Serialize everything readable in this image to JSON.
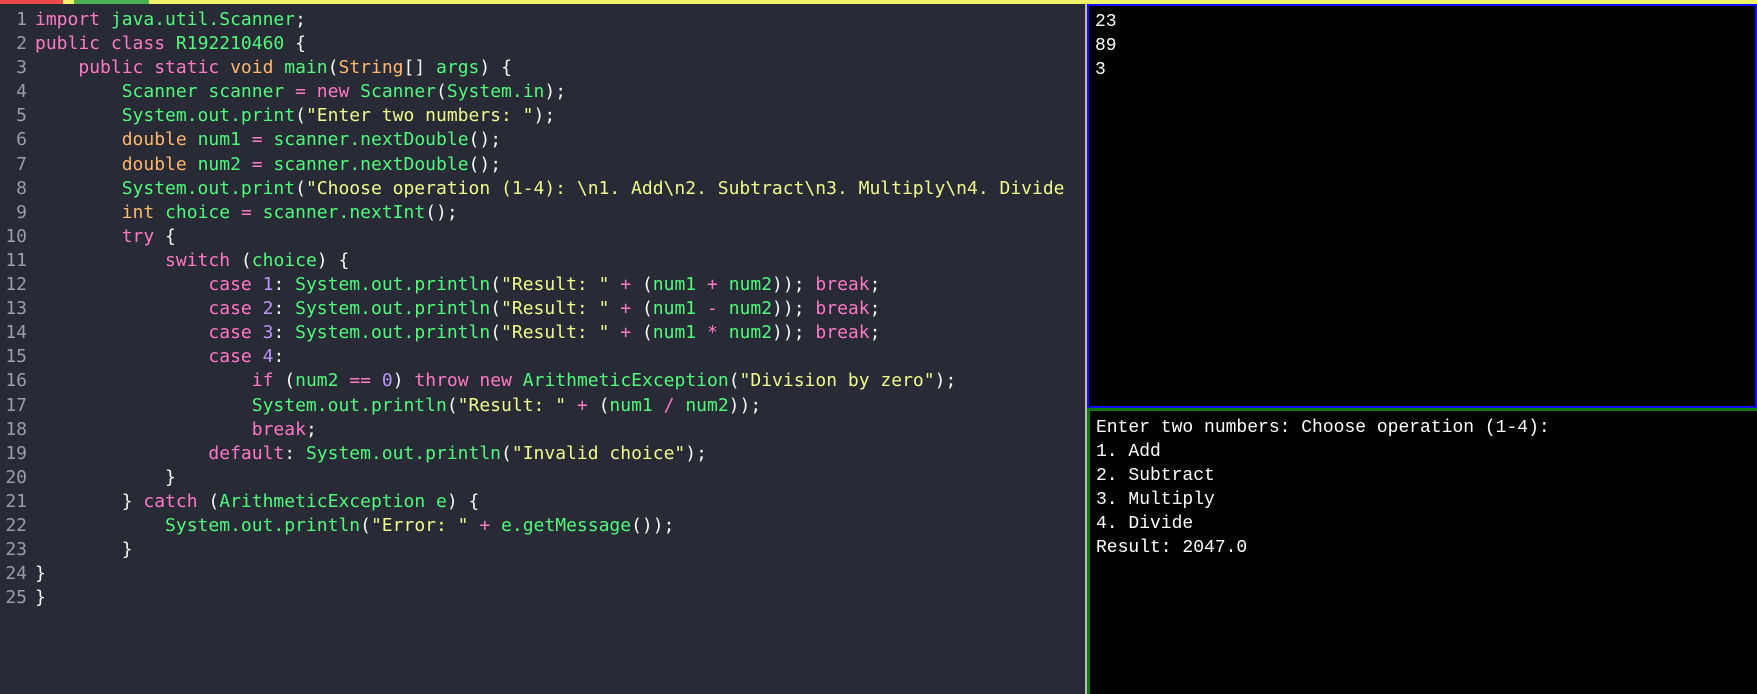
{
  "colors": {
    "background": "#282a36",
    "keyword": "#ff79c6",
    "identifier": "#50fa7b",
    "type": "#ffb86c",
    "string": "#f1fa8c",
    "number": "#bd93f9",
    "input_border": "#1010ff",
    "output_border": "#0b7d0b"
  },
  "editor": {
    "lines": [
      [
        [
          "k",
          "import"
        ],
        [
          "w",
          " "
        ],
        [
          "g",
          "java.util.Scanner"
        ],
        [
          "w",
          ";"
        ]
      ],
      [
        [
          "k",
          "public class"
        ],
        [
          "w",
          " "
        ],
        [
          "g",
          "R192210460"
        ],
        [
          "w",
          " {"
        ]
      ],
      [
        [
          "w",
          "    "
        ],
        [
          "k",
          "public static"
        ],
        [
          "w",
          " "
        ],
        [
          "o",
          "void"
        ],
        [
          "w",
          " "
        ],
        [
          "g",
          "main"
        ],
        [
          "w",
          "("
        ],
        [
          "o",
          "String"
        ],
        [
          "w",
          "[] "
        ],
        [
          "g",
          "args"
        ],
        [
          "w",
          ") {"
        ]
      ],
      [
        [
          "w",
          "        "
        ],
        [
          "g",
          "Scanner scanner"
        ],
        [
          "w",
          " "
        ],
        [
          "k",
          "="
        ],
        [
          "w",
          " "
        ],
        [
          "k",
          "new"
        ],
        [
          "w",
          " "
        ],
        [
          "g",
          "Scanner"
        ],
        [
          "w",
          "("
        ],
        [
          "g",
          "System.in"
        ],
        [
          "w",
          ");"
        ]
      ],
      [
        [
          "w",
          "        "
        ],
        [
          "g",
          "System.out.print"
        ],
        [
          "w",
          "("
        ],
        [
          "y",
          "\"Enter two numbers: \""
        ],
        [
          "w",
          ");"
        ]
      ],
      [
        [
          "w",
          "        "
        ],
        [
          "o",
          "double"
        ],
        [
          "w",
          " "
        ],
        [
          "g",
          "num1"
        ],
        [
          "w",
          " "
        ],
        [
          "k",
          "="
        ],
        [
          "w",
          " "
        ],
        [
          "g",
          "scanner.nextDouble"
        ],
        [
          "w",
          "();"
        ]
      ],
      [
        [
          "w",
          "        "
        ],
        [
          "o",
          "double"
        ],
        [
          "w",
          " "
        ],
        [
          "g",
          "num2"
        ],
        [
          "w",
          " "
        ],
        [
          "k",
          "="
        ],
        [
          "w",
          " "
        ],
        [
          "g",
          "scanner.nextDouble"
        ],
        [
          "w",
          "();"
        ]
      ],
      [
        [
          "w",
          "        "
        ],
        [
          "g",
          "System.out.print"
        ],
        [
          "w",
          "("
        ],
        [
          "y",
          "\"Choose operation (1-4): \\n1. Add\\n2. Subtract\\n3. Multiply\\n4. Divide"
        ]
      ],
      [
        [
          "w",
          "        "
        ],
        [
          "o",
          "int"
        ],
        [
          "w",
          " "
        ],
        [
          "g",
          "choice"
        ],
        [
          "w",
          " "
        ],
        [
          "k",
          "="
        ],
        [
          "w",
          " "
        ],
        [
          "g",
          "scanner.nextInt"
        ],
        [
          "w",
          "();"
        ]
      ],
      [
        [
          "w",
          "        "
        ],
        [
          "k",
          "try"
        ],
        [
          "w",
          " {"
        ]
      ],
      [
        [
          "w",
          "            "
        ],
        [
          "k",
          "switch"
        ],
        [
          "w",
          " ("
        ],
        [
          "g",
          "choice"
        ],
        [
          "w",
          ") {"
        ]
      ],
      [
        [
          "w",
          "                "
        ],
        [
          "k",
          "case"
        ],
        [
          "w",
          " "
        ],
        [
          "p",
          "1"
        ],
        [
          "w",
          ": "
        ],
        [
          "g",
          "System.out.println"
        ],
        [
          "w",
          "("
        ],
        [
          "y",
          "\"Result: \""
        ],
        [
          "w",
          " "
        ],
        [
          "k",
          "+"
        ],
        [
          "w",
          " ("
        ],
        [
          "g",
          "num1"
        ],
        [
          "w",
          " "
        ],
        [
          "k",
          "+"
        ],
        [
          "w",
          " "
        ],
        [
          "g",
          "num2"
        ],
        [
          "w",
          "));"
        ],
        [
          "w",
          " "
        ],
        [
          "k",
          "break"
        ],
        [
          "w",
          ";"
        ]
      ],
      [
        [
          "w",
          "                "
        ],
        [
          "k",
          "case"
        ],
        [
          "w",
          " "
        ],
        [
          "p",
          "2"
        ],
        [
          "w",
          ": "
        ],
        [
          "g",
          "System.out.println"
        ],
        [
          "w",
          "("
        ],
        [
          "y",
          "\"Result: \""
        ],
        [
          "w",
          " "
        ],
        [
          "k",
          "+"
        ],
        [
          "w",
          " ("
        ],
        [
          "g",
          "num1"
        ],
        [
          "w",
          " "
        ],
        [
          "k",
          "-"
        ],
        [
          "w",
          " "
        ],
        [
          "g",
          "num2"
        ],
        [
          "w",
          "));"
        ],
        [
          "w",
          " "
        ],
        [
          "k",
          "break"
        ],
        [
          "w",
          ";"
        ]
      ],
      [
        [
          "w",
          "                "
        ],
        [
          "k",
          "case"
        ],
        [
          "w",
          " "
        ],
        [
          "p",
          "3"
        ],
        [
          "w",
          ": "
        ],
        [
          "g",
          "System.out.println"
        ],
        [
          "w",
          "("
        ],
        [
          "y",
          "\"Result: \""
        ],
        [
          "w",
          " "
        ],
        [
          "k",
          "+"
        ],
        [
          "w",
          " ("
        ],
        [
          "g",
          "num1"
        ],
        [
          "w",
          " "
        ],
        [
          "k",
          "*"
        ],
        [
          "w",
          " "
        ],
        [
          "g",
          "num2"
        ],
        [
          "w",
          "));"
        ],
        [
          "w",
          " "
        ],
        [
          "k",
          "break"
        ],
        [
          "w",
          ";"
        ]
      ],
      [
        [
          "w",
          "                "
        ],
        [
          "k",
          "case"
        ],
        [
          "w",
          " "
        ],
        [
          "p",
          "4"
        ],
        [
          "w",
          ":"
        ]
      ],
      [
        [
          "w",
          "                    "
        ],
        [
          "k",
          "if"
        ],
        [
          "w",
          " ("
        ],
        [
          "g",
          "num2"
        ],
        [
          "w",
          " "
        ],
        [
          "k",
          "=="
        ],
        [
          "w",
          " "
        ],
        [
          "p",
          "0"
        ],
        [
          "w",
          ") "
        ],
        [
          "k",
          "throw new"
        ],
        [
          "w",
          " "
        ],
        [
          "g",
          "ArithmeticException"
        ],
        [
          "w",
          "("
        ],
        [
          "y",
          "\"Division by zero\""
        ],
        [
          "w",
          ");"
        ]
      ],
      [
        [
          "w",
          "                    "
        ],
        [
          "g",
          "System.out.println"
        ],
        [
          "w",
          "("
        ],
        [
          "y",
          "\"Result: \""
        ],
        [
          "w",
          " "
        ],
        [
          "k",
          "+"
        ],
        [
          "w",
          " ("
        ],
        [
          "g",
          "num1"
        ],
        [
          "w",
          " "
        ],
        [
          "k",
          "/"
        ],
        [
          "w",
          " "
        ],
        [
          "g",
          "num2"
        ],
        [
          "w",
          "));"
        ]
      ],
      [
        [
          "w",
          "                    "
        ],
        [
          "k",
          "break"
        ],
        [
          "w",
          ";"
        ]
      ],
      [
        [
          "w",
          "                "
        ],
        [
          "k",
          "default"
        ],
        [
          "w",
          ": "
        ],
        [
          "g",
          "System.out.println"
        ],
        [
          "w",
          "("
        ],
        [
          "y",
          "\"Invalid choice\""
        ],
        [
          "w",
          ");"
        ]
      ],
      [
        [
          "w",
          "            }"
        ]
      ],
      [
        [
          "w",
          "        } "
        ],
        [
          "k",
          "catch"
        ],
        [
          "w",
          " ("
        ],
        [
          "g",
          "ArithmeticException e"
        ],
        [
          "w",
          ") {"
        ]
      ],
      [
        [
          "w",
          "            "
        ],
        [
          "g",
          "System.out.println"
        ],
        [
          "w",
          "("
        ],
        [
          "y",
          "\"Error: \""
        ],
        [
          "w",
          " "
        ],
        [
          "k",
          "+"
        ],
        [
          "w",
          " "
        ],
        [
          "g",
          "e.getMessage"
        ],
        [
          "w",
          "());"
        ]
      ],
      [
        [
          "w",
          "        }"
        ]
      ],
      [
        [
          "w",
          "}"
        ]
      ],
      [
        [
          "w",
          "}"
        ]
      ]
    ]
  },
  "input": {
    "text": "23\n89\n3"
  },
  "output": {
    "text": "Enter two numbers: Choose operation (1-4):\n1. Add\n2. Subtract\n3. Multiply\n4. Divide\nResult: 2047.0"
  }
}
